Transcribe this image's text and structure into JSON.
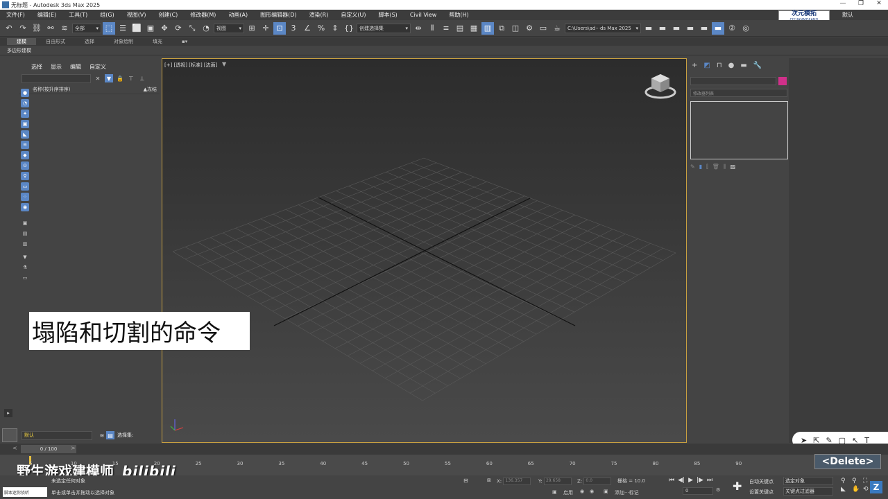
{
  "window": {
    "title": "无标题 - Autodesk 3ds Max 2025",
    "buttons": [
      "—",
      "❐",
      "✕"
    ]
  },
  "menubar": {
    "items": [
      "文件(F)",
      "编辑(E)",
      "工具(T)",
      "组(G)",
      "视图(V)",
      "创建(C)",
      "修改器(M)",
      "动画(A)",
      "图形编辑器(D)",
      "渲染(R)",
      "自定义(U)",
      "脚本(S)",
      "Civil View",
      "帮助(H)"
    ]
  },
  "logo": {
    "main": "次元模拓",
    "sub": "CIYUANMOJIANG"
  },
  "workspace_label": "默认",
  "toolbar": {
    "selection_filter": "全部",
    "ref_coord": "视图",
    "named_sel": "创建选择集",
    "path": "C:\\Users\\ad···ds Max 2025"
  },
  "ribbon": {
    "tabs": [
      "建模",
      "自由形式",
      "选择",
      "对象绘制",
      "填充"
    ],
    "active_tab": "建模",
    "sub_label": "多边形建模"
  },
  "scene_explorer": {
    "menu": [
      "选择",
      "显示",
      "编辑",
      "自定义"
    ],
    "col_name": "名称(按升序排序)",
    "col_frozen": "▲冻结"
  },
  "layer": {
    "name": "默认",
    "label": "选择集:"
  },
  "viewport": {
    "label": "[+] [透视] [标准] [边面]"
  },
  "subtitle": "塌陷和切割的命令",
  "command_panel": {
    "modifier_list": "修改器列表"
  },
  "timeline": {
    "slider": "0 / 100",
    "ticks": [
      "5",
      "10",
      "15",
      "20",
      "25",
      "30",
      "35",
      "40",
      "45",
      "50",
      "55",
      "60",
      "65",
      "70",
      "75",
      "80",
      "85",
      "90"
    ]
  },
  "overlay": {
    "delete": "<Delete>"
  },
  "watermark": {
    "text": "野生游戏建模师",
    "bili": "bilibili"
  },
  "status": {
    "script": "脚本迷你侦听",
    "msg1": "未选定任何对象",
    "msg2": "单击或单击并拖动以选择对象",
    "x_label": "X:",
    "x_val": "136.357",
    "y_label": "Y:",
    "y_val": "29.658",
    "z_label": "Z:",
    "z_val": "0.0",
    "grid": "栅格 = 10.0",
    "enable": "启用",
    "add_tag": "添加···标记",
    "auto_key": "自动关键点",
    "set_key": "设置关键点",
    "sel_obj": "选定对象",
    "key_filter": "关键点过滤器",
    "frame": "0"
  },
  "colors": {
    "accent": "#5b87c5",
    "viewport_border": "#c8a040",
    "object_color": "#d0308a"
  }
}
